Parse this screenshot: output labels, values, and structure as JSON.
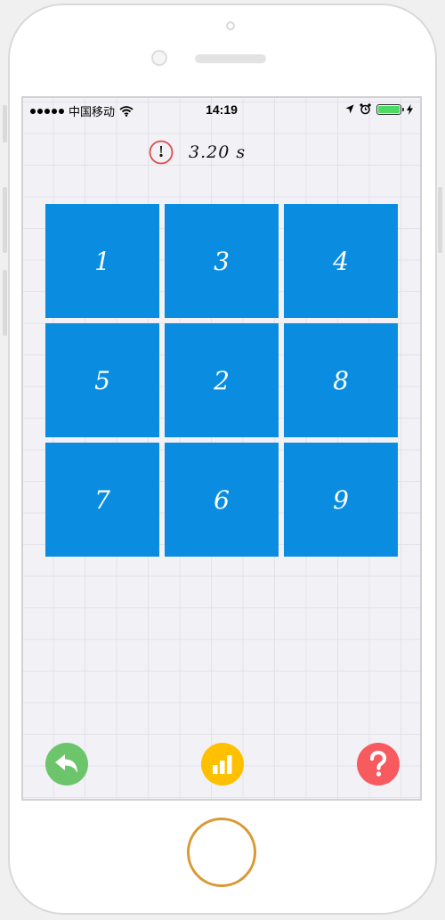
{
  "status_bar": {
    "carrier": "中国移动",
    "time": "14:19"
  },
  "timer": {
    "value": "3.20 s"
  },
  "grid": {
    "tiles": [
      "1",
      "3",
      "4",
      "5",
      "2",
      "8",
      "7",
      "6",
      "9"
    ]
  },
  "bottom_bar": {
    "back_icon": "reply-arrow-icon",
    "stats_icon": "bar-chart-icon",
    "help_icon": "question-mark-icon"
  },
  "colors": {
    "tile": "#0a8de0",
    "back": "#6cc56a",
    "stats": "#ffc000",
    "help": "#f75a5f",
    "timer_icon": "#e04a4a",
    "home_ring": "#d99a35"
  }
}
